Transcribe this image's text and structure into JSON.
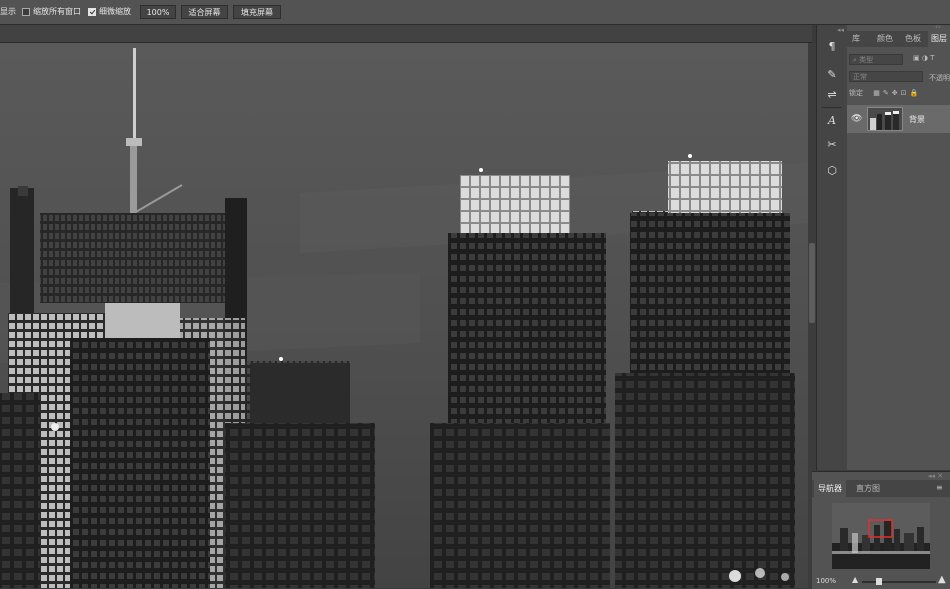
{
  "options_bar": {
    "partial_label": "显示",
    "zoom_all_label": "缩放所有窗口",
    "zoom_all_checked": false,
    "scrubby_label": "细微缩放",
    "scrubby_checked": true,
    "percent_button": "100%",
    "fit_screen_button": "适合屏幕",
    "fill_screen_button": "填充屏幕"
  },
  "tool_icons": [
    "paragraph-icon",
    "brush-settings-icon",
    "adjustments-icon",
    "character-icon",
    "tools-icon",
    "3d-icon"
  ],
  "panel": {
    "collapse": "‹‹",
    "tabs": [
      "库",
      "颜色",
      "色板",
      "图层"
    ],
    "active_tab": "图层",
    "kind_placeholder": "类型",
    "blend_mode": "正常",
    "opacity_label": "不透明",
    "lock_label": "锁定",
    "layer_name": "背景"
  },
  "navigator": {
    "tabs": [
      "导航器",
      "直方图"
    ],
    "active_tab": "导航器",
    "zoom": "100%",
    "view_fraction": 0.2
  }
}
